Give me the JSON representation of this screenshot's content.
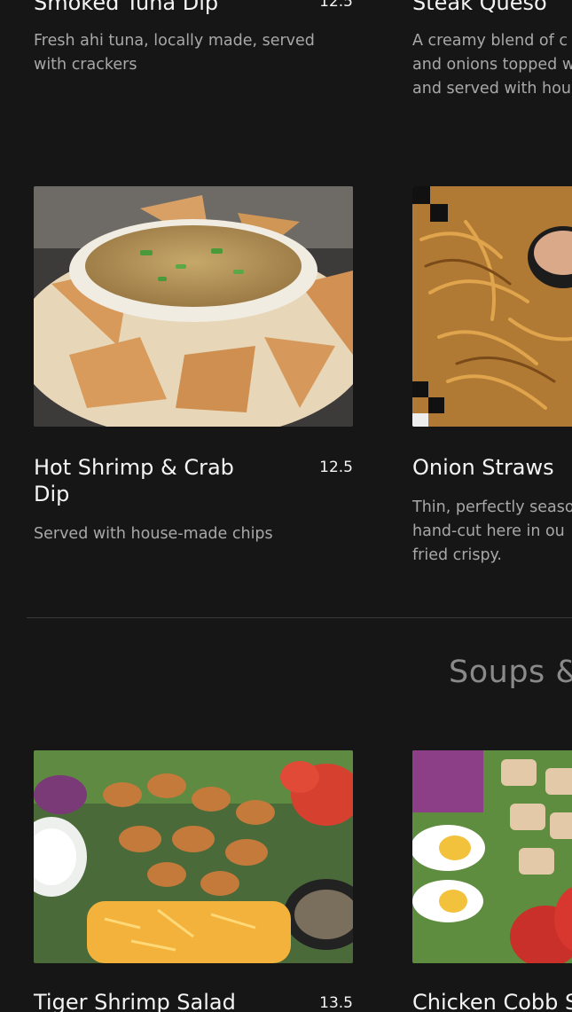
{
  "items": [
    {
      "title": "Smoked Tuna Dip",
      "price": "12.5",
      "description": "Fresh ahi tuna, locally made, served with crackers"
    },
    {
      "title": "Steak Queso",
      "price": "",
      "description": "A creamy blend of c and onions topped w and served with hou"
    },
    {
      "title": "Hot Shrimp & Crab Dip",
      "price": "12.5",
      "description": "Served with house-made chips"
    },
    {
      "title": "Onion Straws",
      "price": "",
      "description": "Thin, perfectly seaso hand-cut here in ou fried crispy."
    },
    {
      "title": "Tiger Shrimp Salad",
      "price": "13.5",
      "description": ""
    },
    {
      "title": "Chicken Cobb S",
      "price": "",
      "description": ""
    }
  ],
  "section": {
    "title": "Soups &"
  },
  "images": {
    "crab_dip": "hot-shrimp-crab-dip-photo",
    "onion_straws": "onion-straws-photo",
    "shrimp_salad": "tiger-shrimp-salad-photo",
    "cobb_salad": "chicken-cobb-salad-photo"
  },
  "colors": {
    "background": "#161616",
    "title": "#f4f4f4",
    "description": "#a8a8a8",
    "section_title": "#8a8a8a",
    "divider": "#3a3a3a"
  }
}
